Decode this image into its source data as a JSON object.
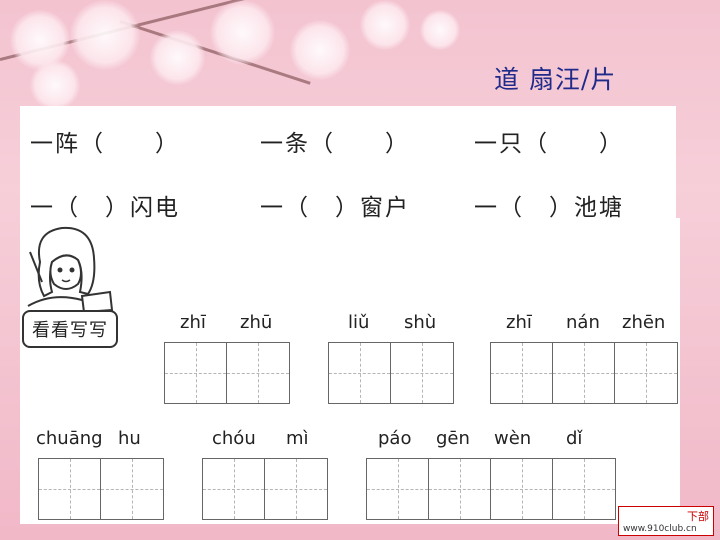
{
  "answer": "道 扇汪/片",
  "row1": [
    "一阵（　　）",
    "一条（　　）",
    "一只（　　）"
  ],
  "row2": [
    "一（　）闪电",
    "一（　）窗户",
    "一（　）池塘"
  ],
  "label": "看看写写",
  "words": [
    {
      "pinyin": [
        "zhī",
        "zhū"
      ]
    },
    {
      "pinyin": [
        "liǔ",
        "shù"
      ]
    },
    {
      "pinyin": [
        "zhī",
        "nán",
        "zhēn"
      ]
    },
    {
      "pinyin": [
        "chuāng",
        "hu"
      ]
    },
    {
      "pinyin": [
        "chóu",
        "mì"
      ]
    },
    {
      "pinyin": [
        "páo",
        "gēn",
        "wèn",
        "dǐ"
      ]
    }
  ],
  "logo": {
    "text": "下部",
    "url": "www.910club.cn"
  },
  "colors": {
    "background": "#f3c3d0",
    "answer": "#1f2a8a",
    "card": "#ffffff"
  }
}
